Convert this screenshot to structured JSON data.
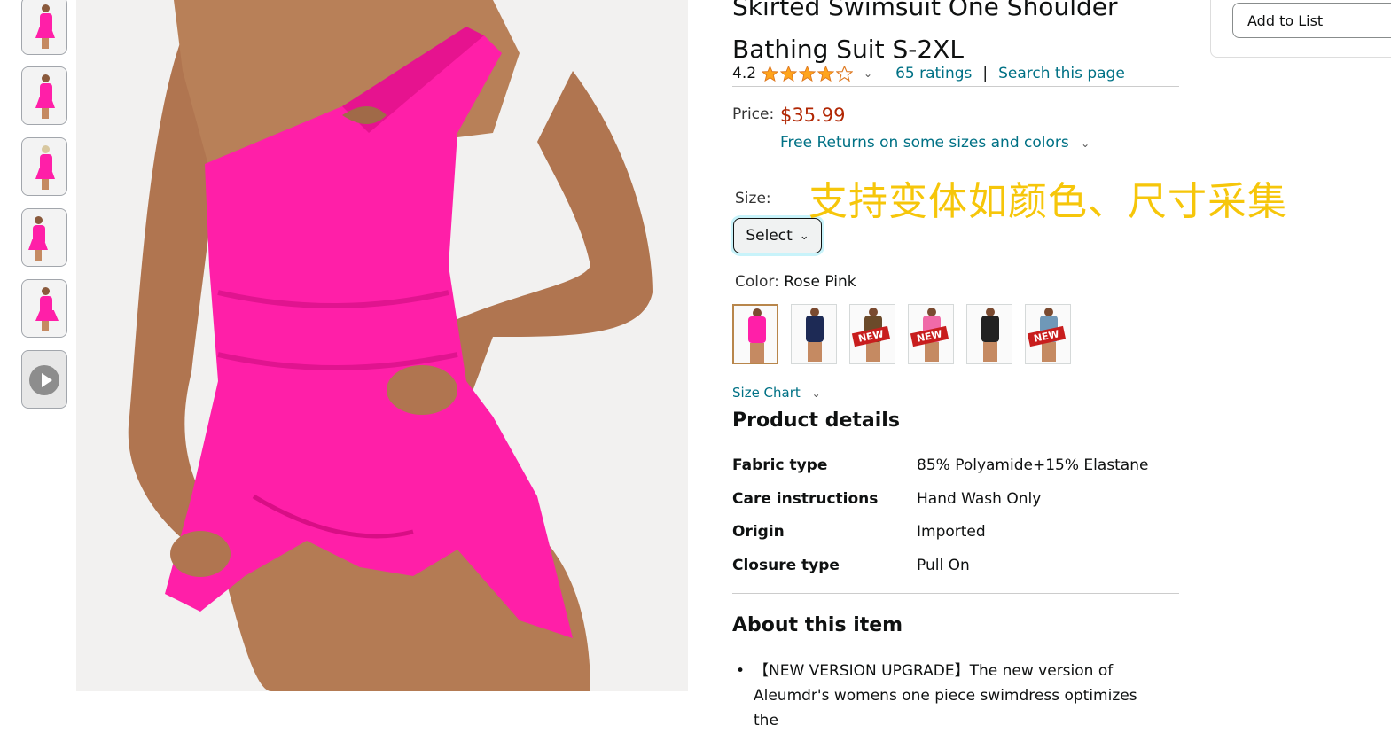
{
  "product": {
    "title_line1": "Skirted Swimsuit One Shoulder",
    "title_line2": "Bathing Suit S-2XL",
    "rating": "4.2",
    "rating_value": 4.2,
    "ratings_count": "65 ratings",
    "search_link": "Search this page",
    "price_label": "Price:",
    "price": "$35.99",
    "returns": "Free Returns on some sizes and colors",
    "size_label": "Size:",
    "size_select": "Select",
    "color_label": "Color:",
    "color_value": "Rose Pink",
    "swatch_badge": "NEW",
    "size_chart": "Size Chart"
  },
  "annotation": "支持变体如颜色、尺寸采集",
  "details": {
    "heading": "Product details",
    "rows": [
      {
        "key": "Fabric type",
        "value": "85% Polyamide+15% Elastane"
      },
      {
        "key": "Care instructions",
        "value": "Hand Wash Only"
      },
      {
        "key": "Origin",
        "value": "Imported"
      },
      {
        "key": "Closure type",
        "value": "Pull On"
      }
    ]
  },
  "about": {
    "heading": "About this item",
    "bullet1": "【NEW VERSION UPGRADE】The new version of Aleumdr's womens one piece swimdress optimizes the"
  },
  "sidebar": {
    "add_to_list": "Add to List"
  },
  "colors": {
    "accent_link": "#007185",
    "price": "#b12704",
    "annotation": "#f6c60a",
    "product_pink": "#ff1fa8"
  }
}
